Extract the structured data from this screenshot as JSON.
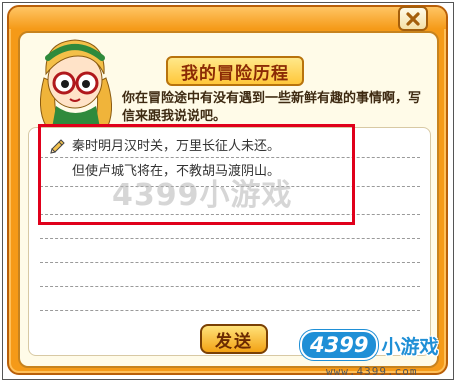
{
  "dialog": {
    "title": "我的冒险历程",
    "prompt": "你在冒险途中有没有遇到一些新鲜有趣的事情啊，写信来跟我说说吧。",
    "letter_lines": [
      "秦时明月汉时关，万里长征人未还。",
      "但使卢城飞将在，不教胡马渡阴山。"
    ],
    "send_label": "发送",
    "close_symbol": "✕"
  },
  "watermark": {
    "text": "4399小游戏"
  },
  "brand": {
    "number": "4399",
    "text": "小游戏",
    "url": "www.4399.com"
  },
  "colors": {
    "panel_orange": "#f59a18",
    "highlight_red": "#e0001b",
    "title_text": "#8b2a05",
    "brand_blue": "#1f8fd6"
  }
}
